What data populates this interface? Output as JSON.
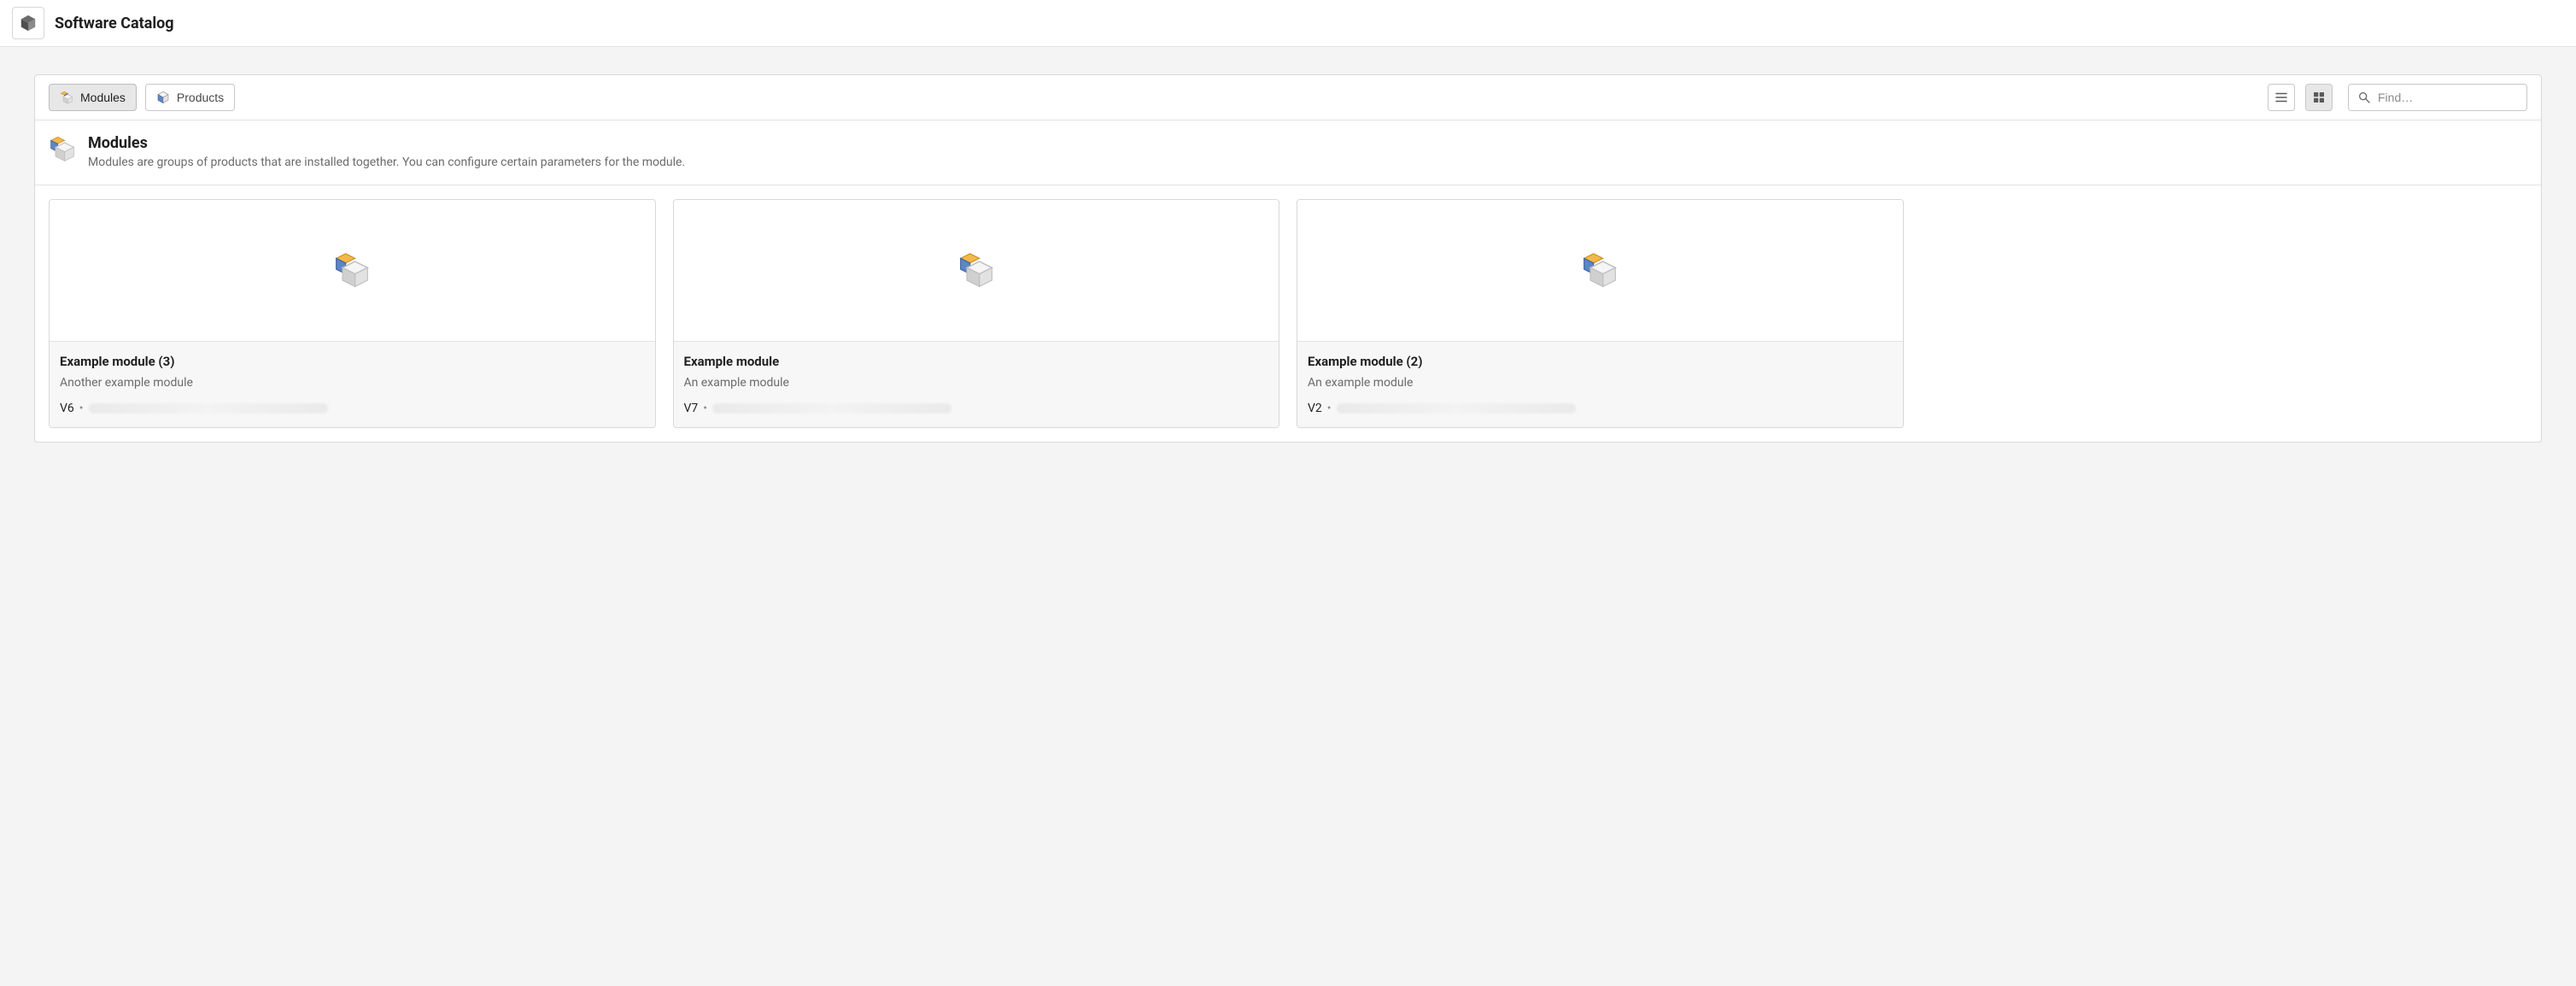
{
  "header": {
    "title": "Software Catalog"
  },
  "toolbar": {
    "tabs": [
      {
        "label": "Modules",
        "active": true
      },
      {
        "label": "Products",
        "active": false
      }
    ],
    "view_list_active": false,
    "view_grid_active": true,
    "search_placeholder": "Find…"
  },
  "section": {
    "title": "Modules",
    "description": "Modules are groups of products that are installed together. You can configure certain parameters for the module."
  },
  "cards": [
    {
      "title": "Example module (3)",
      "description": "Another example module",
      "version": "V6"
    },
    {
      "title": "Example module",
      "description": "An example module",
      "version": "V7"
    },
    {
      "title": "Example module (2)",
      "description": "An example module",
      "version": "V2"
    }
  ]
}
